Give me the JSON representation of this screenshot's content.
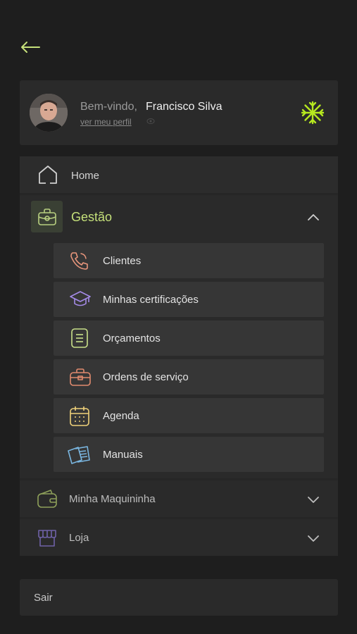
{
  "colors": {
    "background": "#1e1e1e",
    "accent": "#c5e07a",
    "brand_logo": "#b6e81f"
  },
  "profile": {
    "welcome_text": "Bem-vindo,",
    "user_name": "Francisco Silva",
    "profile_link": "ver meu perfil"
  },
  "menu": {
    "home": {
      "label": "Home",
      "icon": "home-icon"
    },
    "gestao": {
      "label": "Gestão",
      "icon": "briefcase-icon",
      "expanded": true,
      "items": [
        {
          "label": "Clientes",
          "icon": "phone-icon"
        },
        {
          "label": "Minhas certificações",
          "icon": "graduation-cap-icon"
        },
        {
          "label": "Orçamentos",
          "icon": "document-icon"
        },
        {
          "label": "Ordens de serviço",
          "icon": "toolbox-icon"
        },
        {
          "label": "Agenda",
          "icon": "calendar-icon"
        },
        {
          "label": "Manuais",
          "icon": "manuals-icon"
        }
      ]
    },
    "maquininha": {
      "label": "Minha Maquininha",
      "icon": "wallet-icon"
    },
    "loja": {
      "label": "Loja",
      "icon": "store-icon"
    }
  },
  "logout": {
    "label": "Sair"
  }
}
